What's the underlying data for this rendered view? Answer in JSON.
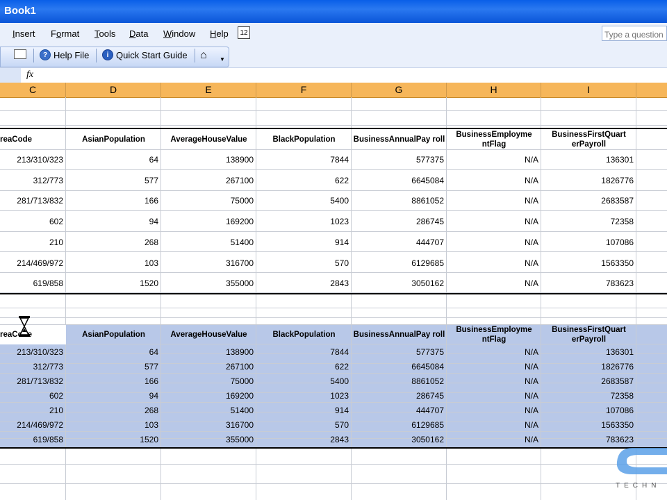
{
  "window": {
    "title": "Book1"
  },
  "menu": [
    {
      "pre": "",
      "u": "I",
      "post": "nsert"
    },
    {
      "pre": "F",
      "u": "o",
      "post": "rmat"
    },
    {
      "pre": "",
      "u": "T",
      "post": "ools"
    },
    {
      "pre": "",
      "u": "D",
      "post": "ata"
    },
    {
      "pre": "",
      "u": "W",
      "post": "indow"
    },
    {
      "pre": "",
      "u": "H",
      "post": "elp"
    }
  ],
  "ask_placeholder": "Type a question",
  "toolbar": {
    "help_file": "Help File",
    "quick_start": "Quick Start Guide"
  },
  "formula": {
    "fx": "fx"
  },
  "columns": [
    "C",
    "D",
    "E",
    "F",
    "G",
    "H",
    "I"
  ],
  "headers": [
    "AreaCode",
    "AsianPopulation",
    "AverageHouseValue",
    "BlackPopulation",
    "BusinessAnnualPay roll",
    "BusinessEmployme ntFlag",
    "BusinessFirstQuart erPayroll"
  ],
  "headers_partial": "reaCode",
  "rows": [
    [
      "213/310/323",
      "64",
      "138900",
      "7844",
      "577375",
      "N/A",
      "136301"
    ],
    [
      "312/773",
      "577",
      "267100",
      "622",
      "6645084",
      "N/A",
      "1826776"
    ],
    [
      "281/713/832",
      "166",
      "75000",
      "5400",
      "8861052",
      "N/A",
      "2683587"
    ],
    [
      "602",
      "94",
      "169200",
      "1023",
      "286745",
      "N/A",
      "72358"
    ],
    [
      "210",
      "268",
      "51400",
      "914",
      "444707",
      "N/A",
      "107086"
    ],
    [
      "214/469/972",
      "103",
      "316700",
      "570",
      "6129685",
      "N/A",
      "1563350"
    ],
    [
      "619/858",
      "1520",
      "355000",
      "2843",
      "3050162",
      "N/A",
      "783623"
    ]
  ],
  "colors": {
    "title_bar": "#0a5fe8",
    "column_header": "#f6b65a",
    "selection": "#b8c8e8"
  },
  "logo_text": "TECHN"
}
